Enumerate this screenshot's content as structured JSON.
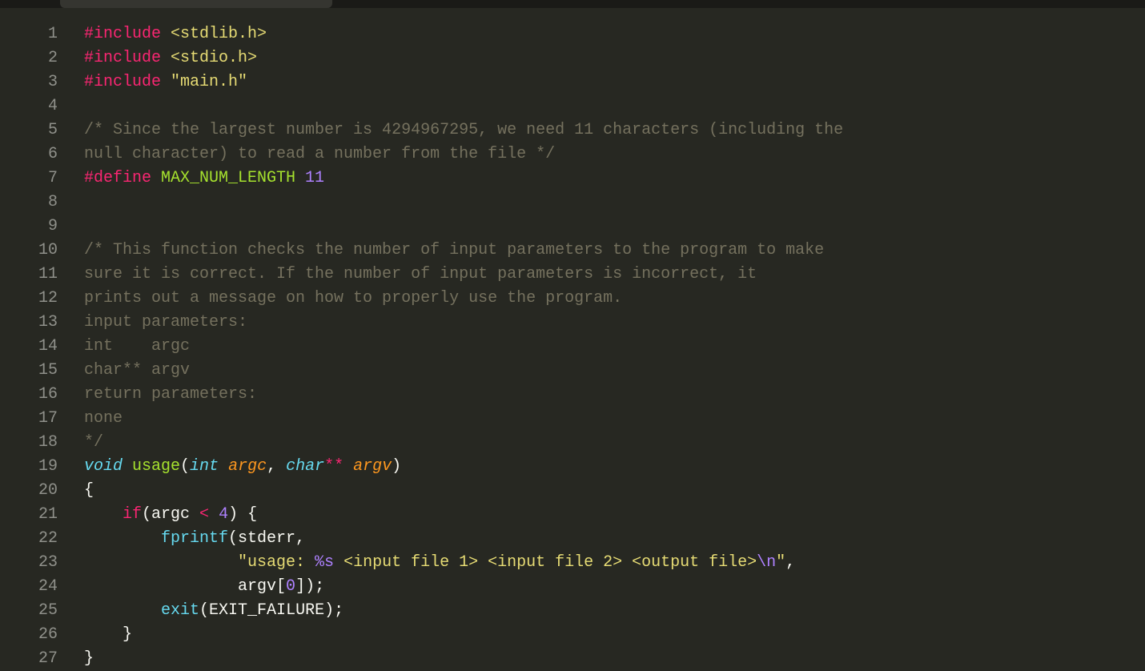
{
  "lineNumbers": [
    "1",
    "2",
    "3",
    "4",
    "5",
    "6",
    "7",
    "8",
    "9",
    "10",
    "11",
    "12",
    "13",
    "14",
    "15",
    "16",
    "17",
    "18",
    "19",
    "20",
    "21",
    "22",
    "23",
    "24",
    "25",
    "26",
    "27"
  ],
  "lines": {
    "l1_include": "#include",
    "l1_str": " <stdlib.h>",
    "l2_include": "#include",
    "l2_str": " <stdio.h>",
    "l3_include": "#include",
    "l3_str": " \"main.h\"",
    "l5_comment": "/* Since the largest number is 4294967295, we need 11 characters (including the",
    "l6_comment": "null character) to read a number from the file */",
    "l7_define": "#define",
    "l7_name": " MAX_NUM_LENGTH",
    "l7_val": " 11",
    "l10_comment": "/* This function checks the number of input parameters to the program to make",
    "l11_comment": "sure it is correct. If the number of input parameters is incorrect, it",
    "l12_comment": "prints out a message on how to properly use the program.",
    "l13_comment": "input parameters:",
    "l14_comment": "int    argc",
    "l15_comment": "char** argv",
    "l16_comment": "return parameters:",
    "l17_comment": "none",
    "l18_comment": "*/",
    "l19_void": "void",
    "l19_func": " usage",
    "l19_open": "(",
    "l19_int": "int",
    "l19_argc": " argc",
    "l19_comma": ", ",
    "l19_char": "char",
    "l19_stars": "**",
    "l19_argv": " argv",
    "l19_close": ")",
    "l20_brace": "{",
    "l21_if": "if",
    "l21_open": "(argc ",
    "l21_op": "<",
    "l21_rest": " ",
    "l21_num": "4",
    "l21_close": ") {",
    "l22_fprintf": "fprintf",
    "l22_args": "(stderr,",
    "l23_str_open": "\"usage: ",
    "l23_fmt": "%s",
    "l23_str_mid": " <input file 1> <input file 2> <output file>",
    "l23_esc": "\\n",
    "l23_str_close": "\"",
    "l23_comma": ",",
    "l24_argv": "argv[",
    "l24_zero": "0",
    "l24_close": "]);",
    "l25_exit": "exit",
    "l25_open": "(",
    "l25_const": "EXIT_FAILURE",
    "l25_close": ");",
    "l26_brace": "}",
    "l27_brace": "}"
  }
}
